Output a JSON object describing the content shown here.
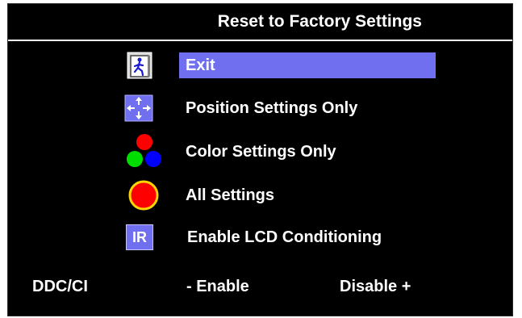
{
  "osd": {
    "title": "Reset to Factory Settings",
    "menu": [
      {
        "label": "Exit",
        "icon": "exit-door-icon",
        "selected": true
      },
      {
        "label": "Position Settings Only",
        "icon": "position-arrows-icon",
        "selected": false
      },
      {
        "label": "Color Settings Only",
        "icon": "rgb-dots-icon",
        "selected": false
      },
      {
        "label": "All Settings",
        "icon": "red-circle-icon",
        "selected": false
      },
      {
        "label": "Enable LCD Conditioning",
        "icon": "ir-badge-icon",
        "icon_text": "IR",
        "selected": false
      }
    ],
    "ddc": {
      "label": "DDC/CI",
      "enable": "- Enable",
      "disable": "Disable +"
    }
  },
  "colors": {
    "background": "#000000",
    "text": "#ffffff",
    "highlight": "#6f6ff0"
  }
}
